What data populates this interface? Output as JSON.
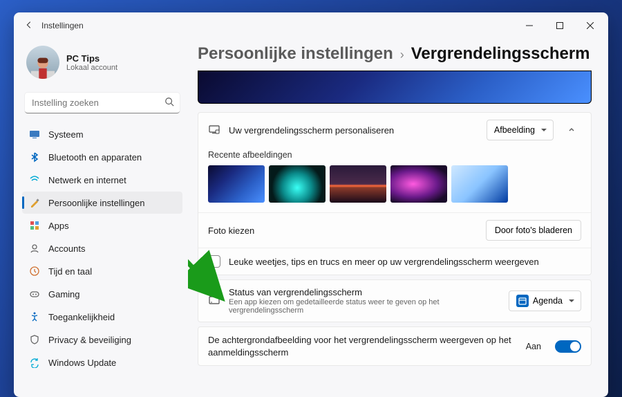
{
  "titlebar": {
    "app_title": "Instellingen"
  },
  "profile": {
    "name": "PC Tips",
    "subtitle": "Lokaal account"
  },
  "search": {
    "placeholder": "Instelling zoeken"
  },
  "sidebar": {
    "items": [
      {
        "label": "Systeem"
      },
      {
        "label": "Bluetooth en apparaten"
      },
      {
        "label": "Netwerk en internet"
      },
      {
        "label": "Persoonlijke instellingen"
      },
      {
        "label": "Apps"
      },
      {
        "label": "Accounts"
      },
      {
        "label": "Tijd en taal"
      },
      {
        "label": "Gaming"
      },
      {
        "label": "Toegankelijkheid"
      },
      {
        "label": "Privacy & beveiliging"
      },
      {
        "label": "Windows Update"
      }
    ]
  },
  "breadcrumb": {
    "parent": "Persoonlijke instellingen",
    "current": "Vergrendelingsscherm"
  },
  "personalize": {
    "title": "Uw vergrendelingsscherm personaliseren",
    "dropdown_value": "Afbeelding",
    "recent_label": "Recente afbeeldingen",
    "choose_photo_label": "Foto kiezen",
    "browse_button": "Door foto's bladeren",
    "tips_checkbox_label": "Leuke weetjes, tips en trucs en meer op uw vergrendelingsscherm weergeven"
  },
  "status": {
    "title": "Status van vergrendelingsscherm",
    "subtitle": "Een app kiezen om gedetailleerde status weer te geven op het vergrendelingsscherm",
    "dropdown_value": "Agenda"
  },
  "background": {
    "label": "De achtergrondafbeelding voor het vergrendelingsscherm weergeven op het aanmeldingsscherm",
    "toggle_label": "Aan"
  }
}
